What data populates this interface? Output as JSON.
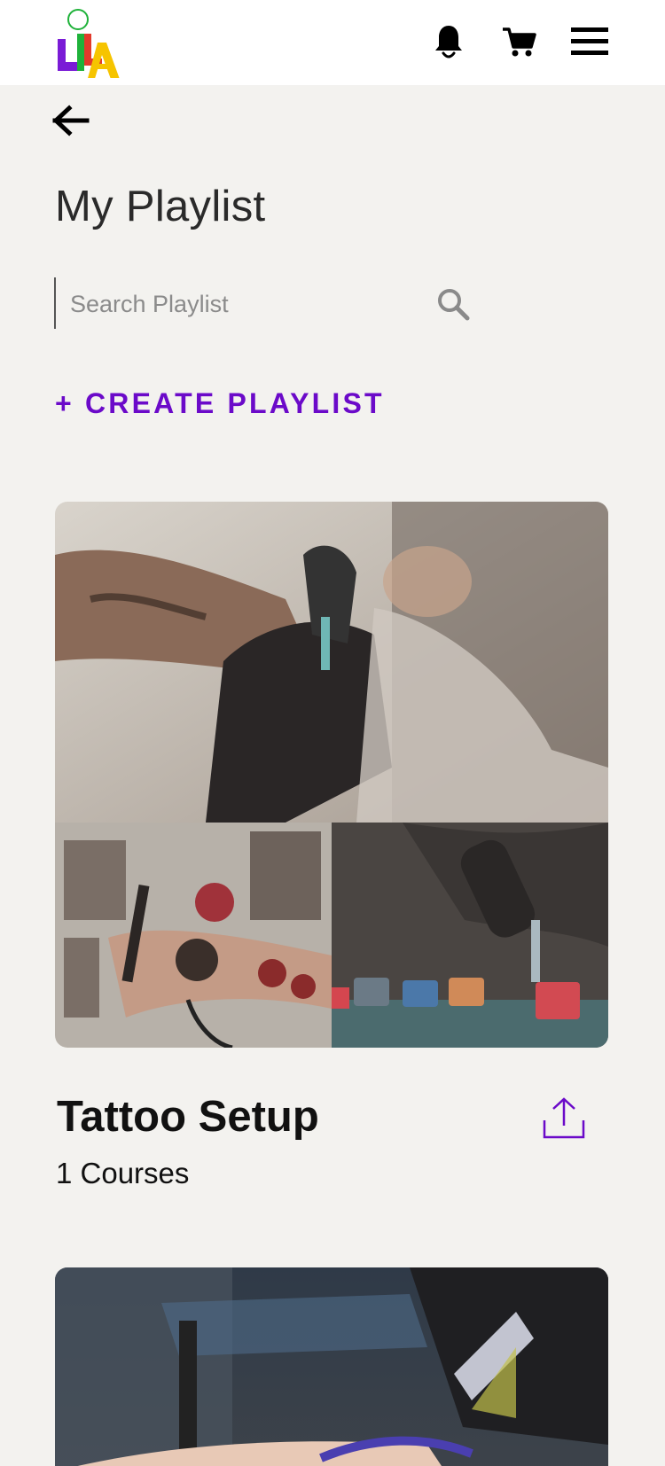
{
  "header": {
    "logo": {
      "name": "lila-logo",
      "letters": "LILA",
      "colors": [
        "#7a1bd6",
        "#1fb23a",
        "#e23a2b",
        "#f6c400"
      ]
    },
    "icons": [
      "bell-icon",
      "cart-icon",
      "menu-icon"
    ]
  },
  "nav": {
    "back_icon": "arrow-left-icon"
  },
  "page": {
    "title": "My Playlist"
  },
  "search": {
    "placeholder": "Search Playlist",
    "value": "",
    "icon": "search-icon"
  },
  "actions": {
    "create_label": "+ CREATE PLAYLIST"
  },
  "playlists": [
    {
      "name": "Tattoo Setup",
      "count": "1 Courses",
      "share_icon": "share-icon"
    },
    {
      "name": "",
      "count": ""
    }
  ],
  "colors": {
    "accent": "#6b0ac9",
    "background": "#f3f2ef",
    "header_bg": "#ffffff"
  }
}
